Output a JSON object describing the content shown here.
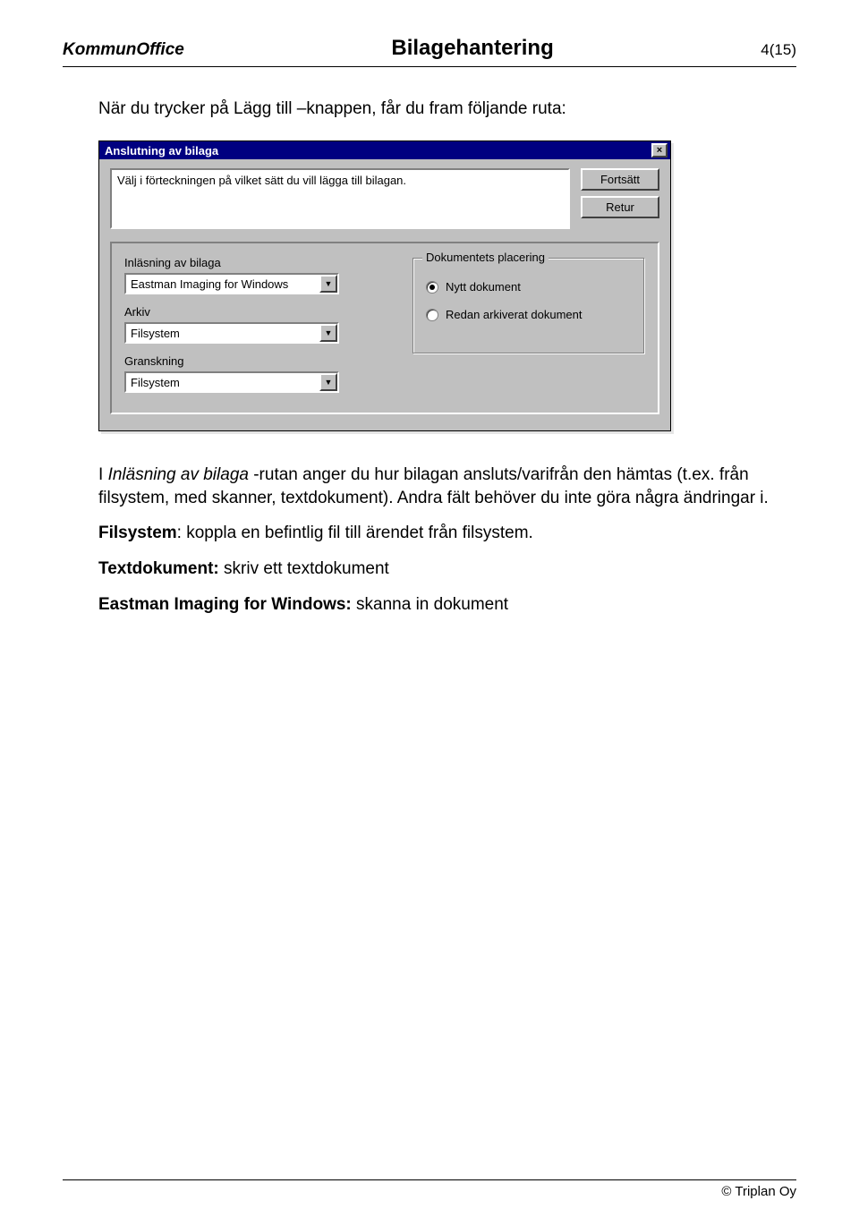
{
  "header": {
    "left": "KommunOffice",
    "center": "Bilagehantering",
    "right": "4(15)"
  },
  "intro": "När du trycker på Lägg till –knappen, får du fram följande ruta:",
  "dialog": {
    "title": "Anslutning av bilaga",
    "close": "×",
    "instruction": "Välj i förteckningen på vilket sätt du vill lägga till bilagan.",
    "btn_continue": "Fortsätt",
    "btn_return": "Retur",
    "labels": {
      "inlasning": "Inläsning av bilaga",
      "arkiv": "Arkiv",
      "granskning": "Granskning"
    },
    "values": {
      "inlasning": "Eastman Imaging for Windows",
      "arkiv": "Filsystem",
      "granskning": "Filsystem"
    },
    "groupbox": {
      "legend": "Dokumentets placering",
      "opt1": "Nytt dokument",
      "opt2": "Redan arkiverat dokument"
    }
  },
  "body": {
    "p1_prefix": "I ",
    "p1_ital": "Inläsning av bilaga",
    "p1_rest": " -rutan anger du hur bilagan ansluts/varifrån den hämtas (t.ex. från filsystem, med skanner, textdokument). Andra fält behöver du inte göra några ändringar i.",
    "p2_bold": "Filsystem",
    "p2_rest": ": koppla en befintlig fil till ärendet från filsystem.",
    "p3_bold": "Textdokument:",
    "p3_rest": " skriv ett textdokument",
    "p4_bold": "Eastman Imaging for Windows:",
    "p4_rest": " skanna in dokument"
  },
  "footer": {
    "copyright": "©  Triplan Oy"
  }
}
